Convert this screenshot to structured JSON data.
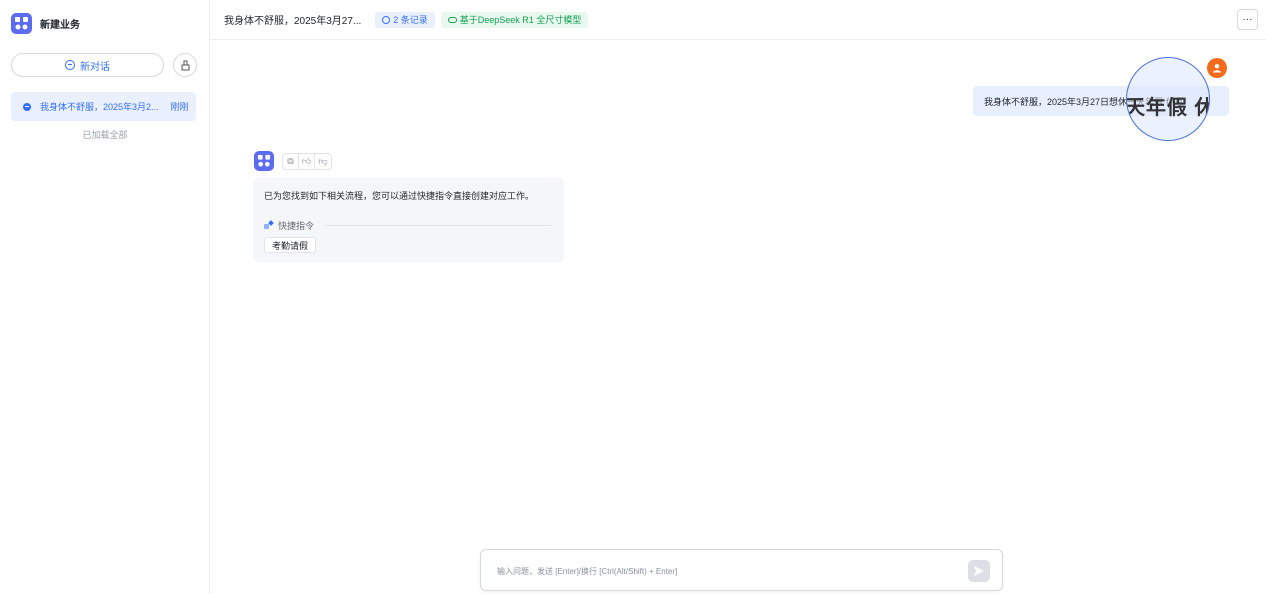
{
  "sidebar": {
    "brand_title": "新建业务",
    "new_chat_label": "新对话",
    "sessions": [
      {
        "title": "我身体不舒服，2025年3月2...",
        "time": "刚刚"
      }
    ],
    "loaded_all": "已加载全部"
  },
  "header": {
    "title": "我身体不舒服，2025年3月27...",
    "records": "2 条记录",
    "model": "基于DeepSeek R1 全尺寸模型",
    "more": "···"
  },
  "chat": {
    "user_message": "我身体不舒服，2025年3月27日想休一天年假 休息",
    "magnifier_text": "天年假 休",
    "bot_message": "已为您找到如下相关流程，您可以通过快捷指令直接创建对应工作。",
    "shortcut_title": "快捷指令",
    "shortcut_button": "考勤请假"
  },
  "input": {
    "placeholder": "输入问题，发送 [Enter]/换行 [Ctrl(Alt/Shift) + Enter]"
  },
  "colors": {
    "accent": "#3370ff",
    "brand": "#5b6cf0",
    "model_green": "#12a150",
    "user_avatar": "#f46b1c"
  }
}
